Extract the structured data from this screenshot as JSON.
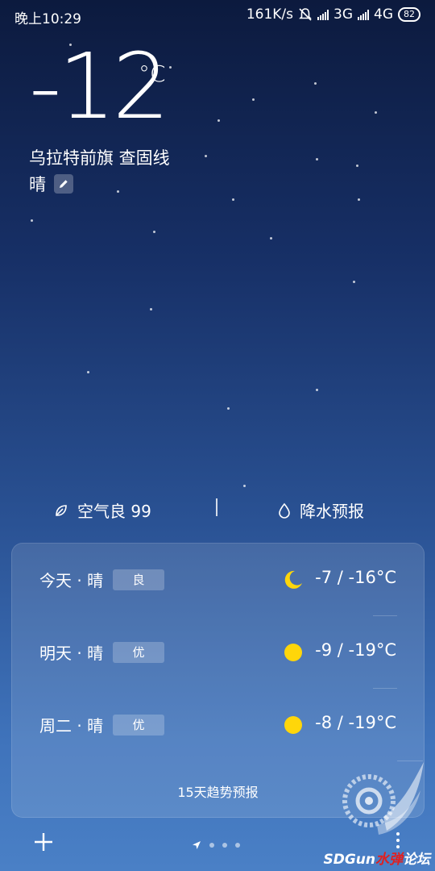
{
  "status_bar": {
    "time": "晚上10:29",
    "speed": "161K/s",
    "net1": "3G",
    "net2": "4G",
    "battery": "82"
  },
  "current": {
    "temperature": "-12",
    "unit": "°C",
    "location": "乌拉特前旗  查固线",
    "condition": "晴"
  },
  "metrics": {
    "air_quality": "空气良 99",
    "rain_forecast": "降水预报"
  },
  "forecast": [
    {
      "day": "今天 · 晴",
      "quality": "良",
      "icon": "moon-icon",
      "range": "-7 / -16°C"
    },
    {
      "day": "明天 · 晴",
      "quality": "优",
      "icon": "sun-icon",
      "range": "-9 / -19°C"
    },
    {
      "day": "周二 · 晴",
      "quality": "优",
      "icon": "sun-icon",
      "range": "-8 / -19°C"
    }
  ],
  "trend_label": "15天趋势预报",
  "watermark": {
    "prefix": "SDGun",
    "red": "水弹",
    "suffix": "论坛"
  },
  "colors": {
    "sun": "#ffd60a",
    "moon": "#ffd60a"
  }
}
